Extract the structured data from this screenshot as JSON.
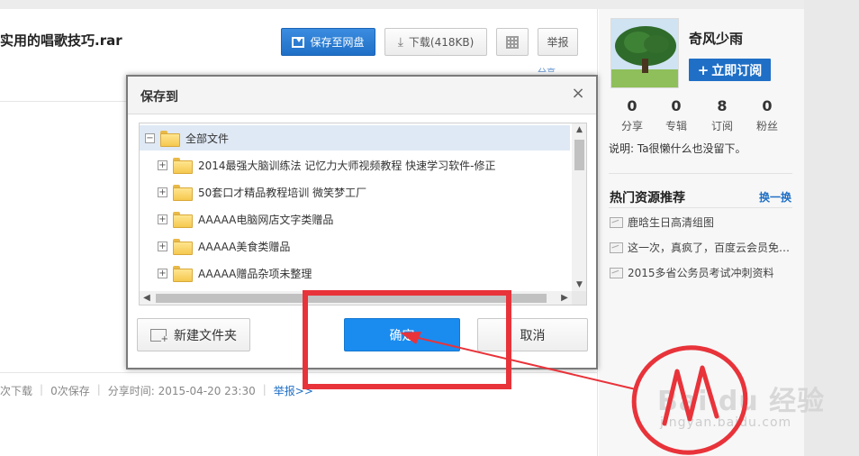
{
  "page": {
    "file_title": "实用的唱歌技巧.rar",
    "buttons": {
      "save_to_netdisk": "保存至网盘",
      "download": "下载(418KB)",
      "report": "举报"
    },
    "corner_link": "分享",
    "stats": {
      "downloads": "次下载",
      "saves": "0次保存",
      "share_time": "分享时间: 2015-04-20 23:30",
      "report_link": "举报>>"
    }
  },
  "sidebar": {
    "user_name": "奇风少雨",
    "subscribe_label": "立即订阅",
    "stats": [
      {
        "value": "0",
        "label": "分享"
      },
      {
        "value": "0",
        "label": "专辑"
      },
      {
        "value": "8",
        "label": "订阅"
      },
      {
        "value": "0",
        "label": "粉丝"
      }
    ],
    "description": "说明: Ta很懒什么也没留下。",
    "hot_title": "热门资源推荐",
    "hot_refresh": "换一换",
    "hot_items": [
      "鹿晗生日高清组图",
      "这一次，真疯了，百度云会员免…",
      "2015多省公务员考试冲刺资料"
    ]
  },
  "dialog": {
    "title": "保存到",
    "close_glyph": "×",
    "root": {
      "expander": "−",
      "label": "全部文件"
    },
    "folders": [
      {
        "expander": "+",
        "label": "2014最强大脑训练法 记忆力大师视频教程 快速学习软件-修正"
      },
      {
        "expander": "+",
        "label": "50套口才精品教程培训 微笑梦工厂"
      },
      {
        "expander": "+",
        "label": "AAAAA电脑网店文字类赠品"
      },
      {
        "expander": "+",
        "label": "AAAAA美食类赠品"
      },
      {
        "expander": "+",
        "label": "AAAAA赠品杂项未整理"
      }
    ],
    "new_folder": "新建文件夹",
    "confirm": "确定",
    "cancel": "取消"
  },
  "watermark": {
    "logo": "Bai du 经验",
    "url": "jingyan.baidu.com"
  },
  "colors": {
    "brand_blue": "#1f6fc6",
    "confirm_blue": "#1a8cf0",
    "annotation_red": "#e8333a"
  }
}
